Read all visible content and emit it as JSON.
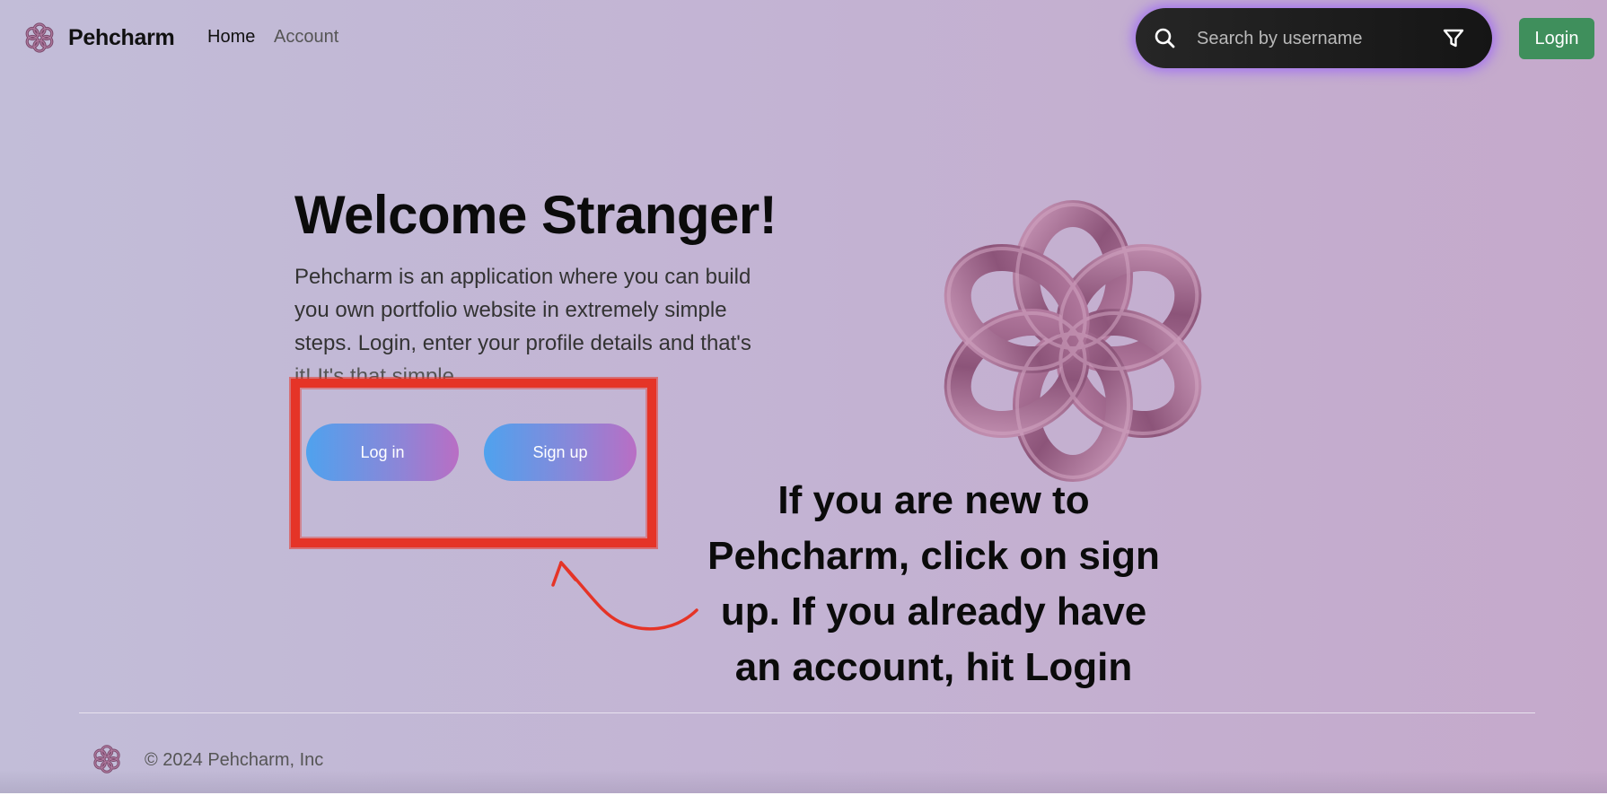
{
  "navbar": {
    "brand_name": "Pehcharm",
    "links": [
      {
        "label": "Home"
      },
      {
        "label": "Account"
      }
    ],
    "search": {
      "placeholder": "Search by username",
      "icon": "search-icon",
      "filter_icon": "filter-icon"
    },
    "login_label": "Login"
  },
  "hero": {
    "title": "Welcome Stranger!",
    "description_lines": [
      "Pehcharm is an application where you can build",
      "you own portfolio website in extremely simple",
      "steps. Login, enter your profile details and that's",
      "it! It's that simple."
    ],
    "buttons": {
      "login_label": "Log in",
      "signup_label": "Sign up"
    }
  },
  "annotation": {
    "lines": [
      "If you are new to",
      "Pehcharm, click on sign",
      "up. If you already have",
      "an account, hit Login"
    ]
  },
  "footer": {
    "copyright": "© 2024 Pehcharm, Inc"
  },
  "colors": {
    "accent_green": "#3f8f5c",
    "highlight_red": "#e53427",
    "search_glow": "#9657ff",
    "flower": "#a56e93"
  }
}
